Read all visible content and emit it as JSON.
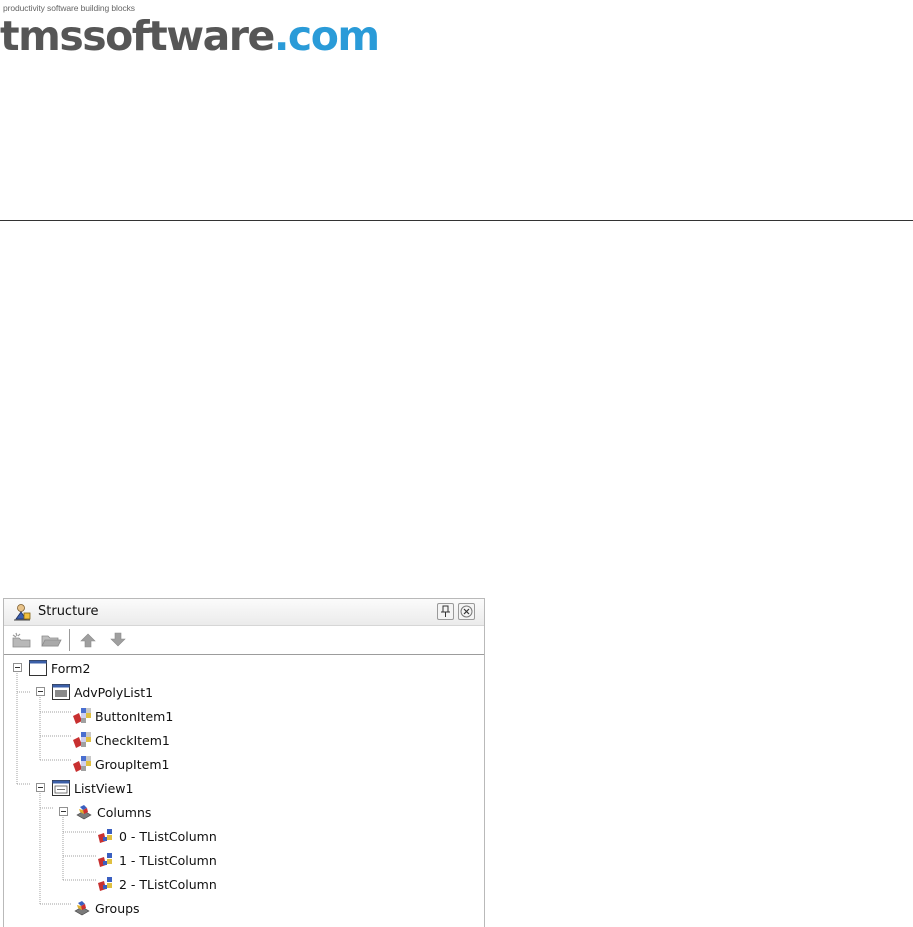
{
  "header": {
    "tagline": "productivity software building blocks",
    "brand_main": "tmssoftware",
    "brand_suffix": ".com",
    "colors": {
      "brand_gray": "#565656",
      "brand_blue": "#2a9bd8"
    }
  },
  "panel": {
    "title": "Structure",
    "title_icon": "structure-icon",
    "buttons": {
      "pin": "pin-icon",
      "close": "close-icon"
    },
    "toolbar": [
      "new-item-icon",
      "open-folder-icon",
      "arrow-up-icon",
      "arrow-down-icon"
    ],
    "tree": [
      {
        "label": "Form2",
        "icon": "form-icon",
        "expanded": true
      },
      {
        "label": "AdvPolyList1",
        "icon": "polylist-icon",
        "expanded": true
      },
      {
        "label": "ButtonItem1",
        "icon": "item-icon"
      },
      {
        "label": "CheckItem1",
        "icon": "item-icon"
      },
      {
        "label": "GroupItem1",
        "icon": "item-icon"
      },
      {
        "label": "ListView1",
        "icon": "listview-icon",
        "expanded": true
      },
      {
        "label": "Columns",
        "icon": "collection-icon",
        "expanded": true
      },
      {
        "label": "0 - TListColumn",
        "icon": "column-icon"
      },
      {
        "label": "1 - TListColumn",
        "icon": "column-icon"
      },
      {
        "label": "2 - TListColumn",
        "icon": "column-icon"
      },
      {
        "label": "Groups",
        "icon": "collection-icon"
      }
    ]
  }
}
